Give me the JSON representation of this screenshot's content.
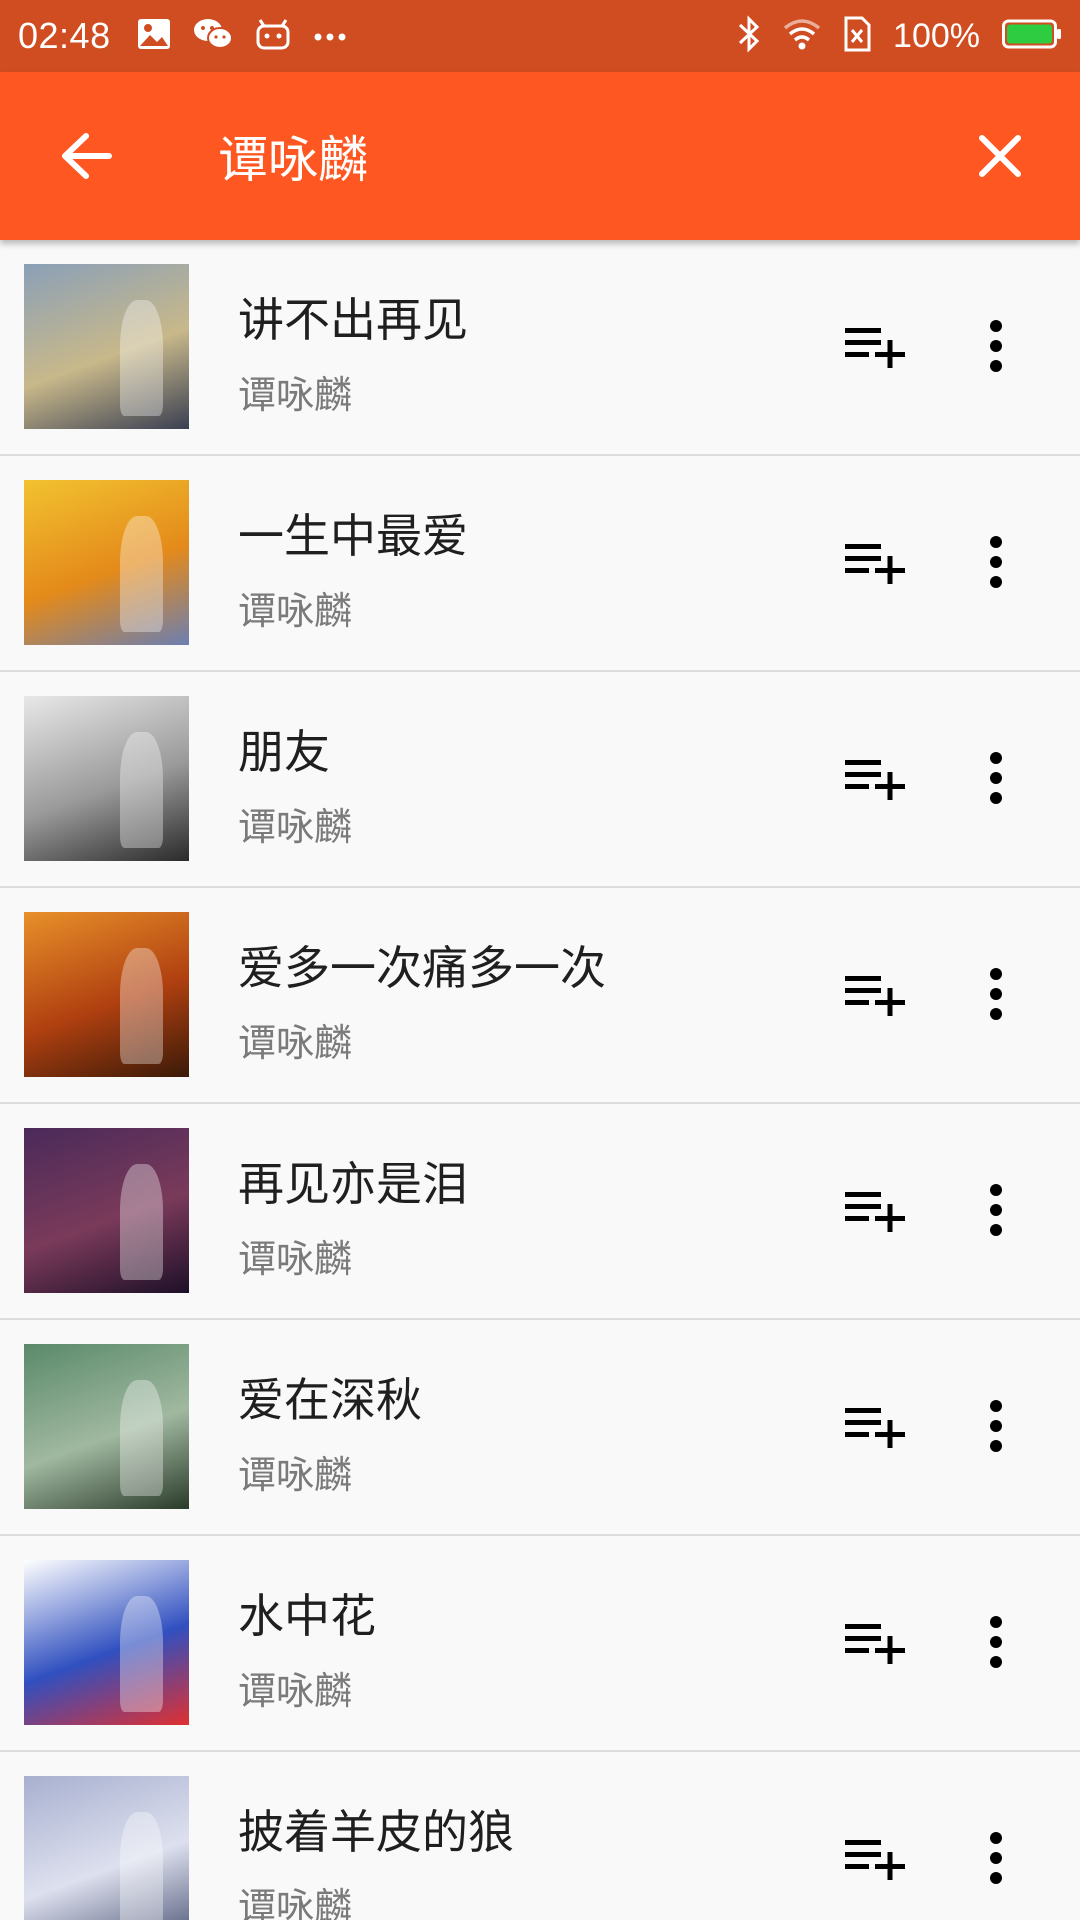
{
  "status_bar": {
    "time": "02:48",
    "battery_percent": "100%",
    "left_icons": [
      "image-icon",
      "wechat-icon",
      "android-icon",
      "more-dots-icon"
    ],
    "right_icons": [
      "bluetooth-icon",
      "wifi-icon",
      "no-sim-icon",
      "battery-icon"
    ],
    "battery_color": "#2ecc40"
  },
  "app_bar": {
    "title": "谭咏麟",
    "back_icon": "arrow-left-icon",
    "close_icon": "close-icon",
    "color": "#ff5722"
  },
  "songs": [
    {
      "title": "讲不出再见",
      "artist": "谭咏麟",
      "art_colors": [
        "#8aa0b8",
        "#c8b88a",
        "#3a3f52"
      ]
    },
    {
      "title": "一生中最爱",
      "artist": "谭咏麟",
      "art_colors": [
        "#f2c230",
        "#e48a1a",
        "#6c7fb0"
      ]
    },
    {
      "title": "朋友",
      "artist": "谭咏麟",
      "art_colors": [
        "#e8e8e8",
        "#9a9a9a",
        "#2a2a2a"
      ]
    },
    {
      "title": "爱多一次痛多一次",
      "artist": "谭咏麟",
      "art_colors": [
        "#e8902a",
        "#b04010",
        "#3a1a08"
      ]
    },
    {
      "title": "再见亦是泪",
      "artist": "谭咏麟",
      "art_colors": [
        "#4a2a5a",
        "#7a3a5a",
        "#1e1028"
      ]
    },
    {
      "title": "爱在深秋",
      "artist": "谭咏麟",
      "art_colors": [
        "#5a8a6a",
        "#a0b8a0",
        "#2a3a2a"
      ]
    },
    {
      "title": "水中花",
      "artist": "谭咏麟",
      "art_colors": [
        "#ffffff",
        "#3050c0",
        "#e03030"
      ]
    },
    {
      "title": "披着羊皮的狼",
      "artist": "谭咏麟",
      "art_colors": [
        "#a8b0d0",
        "#dde0ee",
        "#505878"
      ]
    }
  ],
  "row_actions": {
    "add_icon": "playlist-add-icon",
    "more_icon": "more-vert-icon"
  }
}
